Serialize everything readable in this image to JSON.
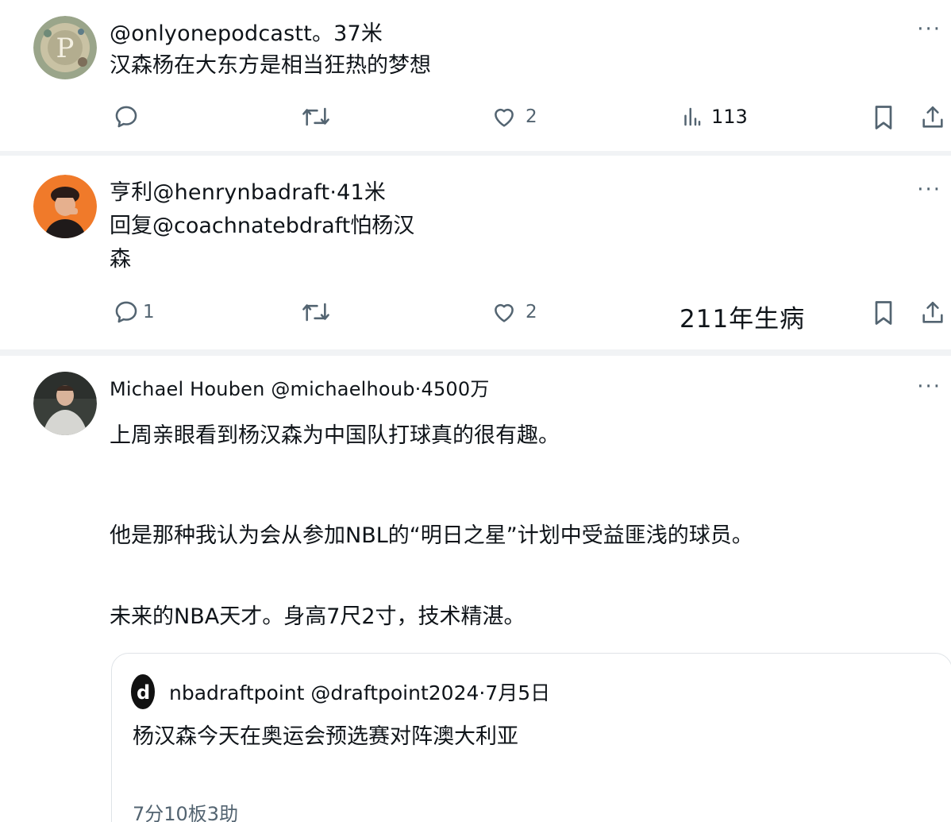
{
  "posts": [
    {
      "header": "@onlyonepodcastt。37米",
      "text": "汉森杨在大东方是相当狂热的梦想",
      "actions": {
        "reply": "",
        "repost": "",
        "like": "2",
        "views": "113"
      }
    },
    {
      "header": "亨利@henrynbadraft·41米",
      "text_line1": "回复@coachnatebdraft怕杨汉",
      "text_line2": "森",
      "actions": {
        "reply": "1",
        "repost": "",
        "like": "2",
        "views_text": "211年生病"
      }
    },
    {
      "header": "Michael Houben @michaelhoub·4500万",
      "paragraphs": [
        "上周亲眼看到杨汉森为中国队打球真的很有趣。",
        "他是那种我认为会从参加NBL的“明日之星”计划中受益匪浅的球员。",
        "未来的NBA天才。身高7尺2寸，技术精湛。"
      ],
      "quote": {
        "avatar_letter": "d",
        "header": "nbadraftpoint @draftpoint2024·7月5日",
        "text": "杨汉森今天在奥运会预选赛对阵澳大利亚",
        "stats": "7分10板3助"
      }
    }
  ],
  "more_glyph": "···",
  "colors": {
    "icon": "#536471",
    "text": "#0f1419",
    "separator": "#f1f3f5",
    "border": "#dfe3e7"
  }
}
